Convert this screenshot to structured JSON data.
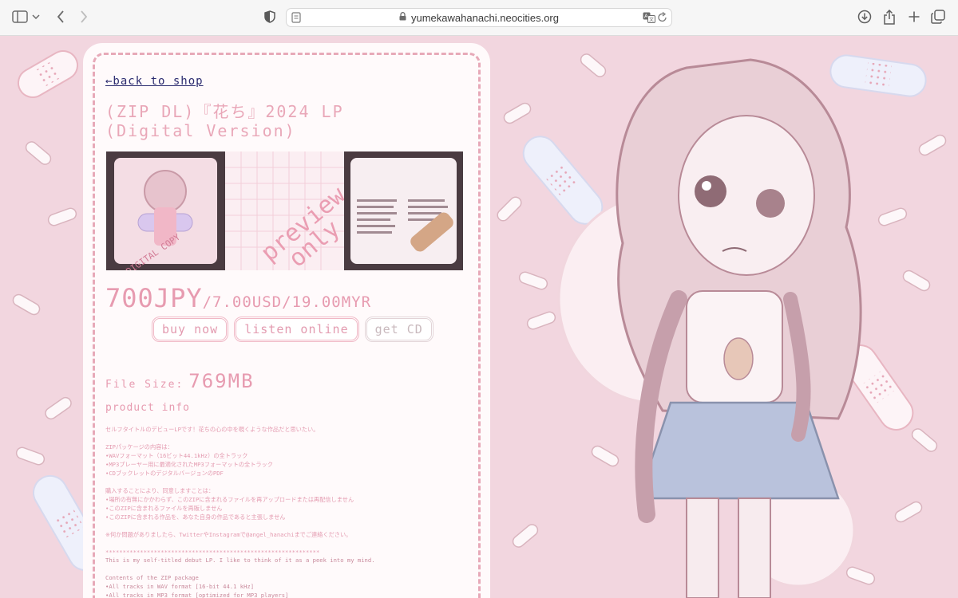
{
  "browser": {
    "url": "yumekawahanachi.neocities.org",
    "icons": [
      "sidebar-icon",
      "chevron-down-icon",
      "back-arrow-icon",
      "forward-arrow-icon",
      "shield-icon",
      "page-icon",
      "lock-icon",
      "translate-icon",
      "reload-icon",
      "download-icon",
      "share-icon",
      "new-tab-icon",
      "tabs-overview-icon"
    ]
  },
  "page": {
    "back_link": "←back to shop",
    "title": "(ZIP DL)『花ち』2024 LP (Digital Version)",
    "images": [
      "cover-art",
      "preview-only",
      "tracklist"
    ],
    "price_main": "700JPY",
    "price_sub": "/7.00USD/19.00MYR",
    "buttons": {
      "buy": "buy now",
      "listen": "listen online",
      "cd": "get CD"
    },
    "file_size_label": "File Size:",
    "file_size_value": "769MB",
    "product_info_heading": "product info",
    "description_jp": "セルフタイトルのデビューLPです！花ちの心の中を覗くような作品だと思いたい。\n\nZIPパッケージの内容は：\n•WAVフォーマット（16ビット44.1kHz）の全トラック\n•MP3プレーヤー用に最適化されたMP3フォーマットの全トラック\n•CDブックレットのデジタルバージョンのPDF\n\n購入することにより、同意しますことは：\n•場所の有無にかかわらず、このZIPに含まれるファイルを再アップロードまたは再配信しません\n•このZIPに含まれるファイルを再販しません\n•このZIPに含まれる作品を、あなた自身の作品であると主張しません\n\n※何か問題がありましたら、TwitterやInstagramで@angel_hanachiまでご連絡ください。\n\n**************************************************************",
    "description_en": "This is my self-titled debut LP. I like to think of it as a peek into my mind.\n\nContents of the ZIP package\n•All tracks in WAV format [16-bit 44.1 kHz]\n•All tracks in MP3 format [optimized for MP3 players]\n•PDF digital version of the CD booklet\n\nBy purchasing, you agree:"
  },
  "colors": {
    "page_bg": "#f2d6df",
    "accent_pink": "#e79bb0",
    "card_bg": "#fffafb",
    "link": "#2b2b6f"
  }
}
